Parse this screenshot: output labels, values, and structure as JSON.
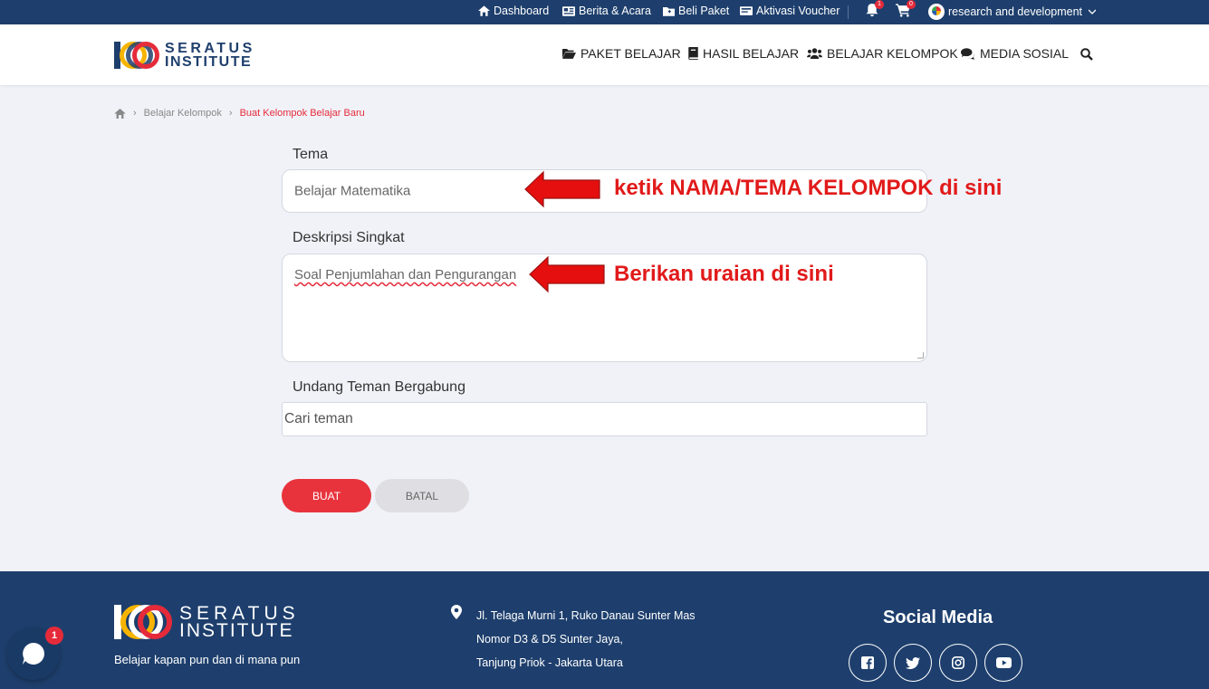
{
  "topbar": {
    "dashboard": "Dashboard",
    "berita": "Berita & Acara",
    "beli_paket": "Beli Paket",
    "aktivasi": "Aktivasi Voucher",
    "notif_count": "1",
    "cart_count": "0",
    "user_name": "research and development"
  },
  "header": {
    "logo_line1": "SERATUS",
    "logo_line2": "INSTITUTE",
    "nav": {
      "paket": "PAKET BELAJAR",
      "hasil": "HASIL BELAJAR",
      "kelompok": "BELAJAR KELOMPOK",
      "medsos": "MEDIA SOSIAL"
    }
  },
  "breadcrumb": {
    "level1": "Belajar Kelompok",
    "level2": "Buat Kelompok Belajar Baru"
  },
  "form": {
    "tema_label": "Tema",
    "tema_value": "Belajar Matematika",
    "desc_label": "Deskripsi Singkat",
    "desc_value": "Soal Penjumlahan dan Pengurangan",
    "invite_label": "Undang Teman Bergabung",
    "invite_placeholder": "Cari teman",
    "buat_label": "BUAT",
    "batal_label": "BATAL"
  },
  "annotations": {
    "tema_hint": "ketik NAMA/TEMA KELOMPOK di sini",
    "desc_hint": "Berikan uraian di sini",
    "color": "#e11a1a"
  },
  "footer": {
    "logo_line1": "SERATUS",
    "logo_line2": "INSTITUTE",
    "tagline": "Belajar kapan pun dan di mana pun",
    "address": [
      "Jl. Telaga Murni 1, Ruko Danau Sunter Mas",
      "Nomor D3 & D5 Sunter Jaya,",
      "Tanjung Priok - Jakarta Utara"
    ],
    "social_title": "Social Media"
  },
  "chat": {
    "badge": "1"
  },
  "colors": {
    "navy": "#1e3f6d",
    "accent": "#e52b3a",
    "yellow": "#f6b400"
  }
}
